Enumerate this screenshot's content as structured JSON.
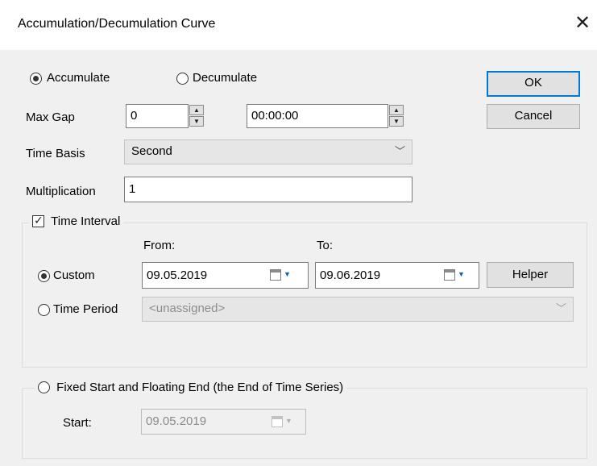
{
  "window": {
    "title": "Accumulation/Decumulation Curve",
    "close_glyph": "✕"
  },
  "mode": {
    "accumulate_label": "Accumulate",
    "decumulate_label": "Decumulate",
    "selected": "accumulate"
  },
  "buttons": {
    "ok": "OK",
    "cancel": "Cancel",
    "helper": "Helper"
  },
  "max_gap": {
    "label": "Max Gap",
    "value": "0",
    "time_value": "00:00:00"
  },
  "time_basis": {
    "label": "Time Basis",
    "value": "Second"
  },
  "multiplication": {
    "label": "Multiplication",
    "value": "1"
  },
  "time_interval": {
    "label": "Time Interval",
    "checked": true,
    "from_label": "From:",
    "to_label": "To:",
    "custom_label": "Custom",
    "from_value": "09.05.2019",
    "to_value": "09.06.2019",
    "time_period_label": "Time Period",
    "time_period_value": "<unassigned>"
  },
  "fixed_start": {
    "label": "Fixed Start and Floating End (the End of Time Series)",
    "start_label": "Start:",
    "start_value": "09.05.2019"
  }
}
